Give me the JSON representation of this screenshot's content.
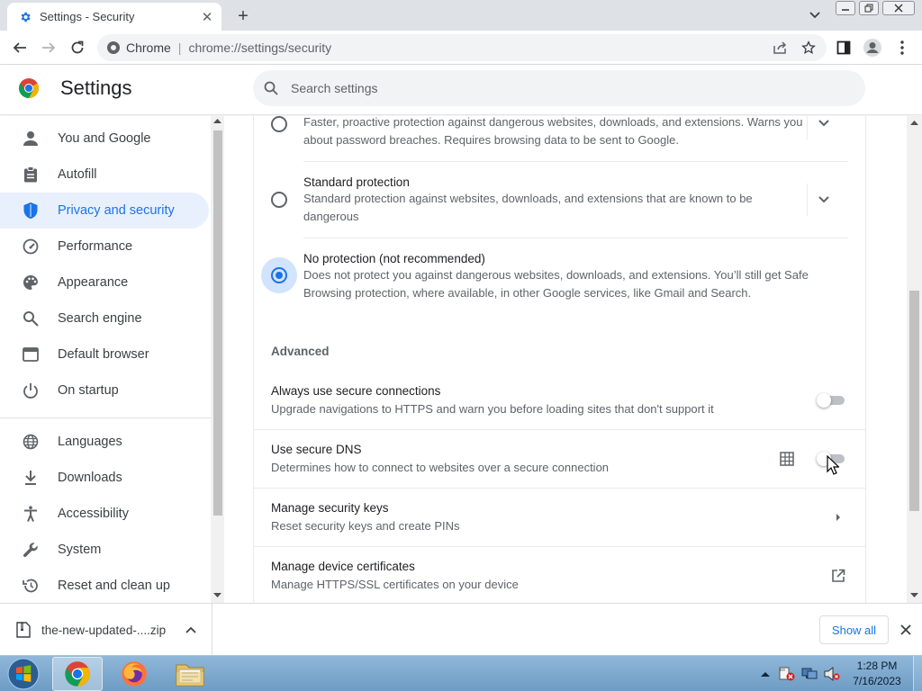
{
  "browser": {
    "tab_title": "Settings - Security",
    "omnibox_chip": "Chrome",
    "omnibox_url": "chrome://settings/security"
  },
  "settings": {
    "title": "Settings",
    "search_placeholder": "Search settings"
  },
  "sidebar": {
    "items": [
      {
        "label": "You and Google",
        "icon": "person-icon"
      },
      {
        "label": "Autofill",
        "icon": "clipboard-icon"
      },
      {
        "label": "Privacy and security",
        "icon": "shield-icon",
        "active": true
      },
      {
        "label": "Performance",
        "icon": "speedometer-icon"
      },
      {
        "label": "Appearance",
        "icon": "palette-icon"
      },
      {
        "label": "Search engine",
        "icon": "search-icon"
      },
      {
        "label": "Default browser",
        "icon": "browser-window-icon"
      },
      {
        "label": "On startup",
        "icon": "power-icon"
      },
      {
        "label": "Languages",
        "icon": "globe-icon"
      },
      {
        "label": "Downloads",
        "icon": "download-icon"
      },
      {
        "label": "Accessibility",
        "icon": "accessibility-icon"
      },
      {
        "label": "System",
        "icon": "wrench-icon"
      },
      {
        "label": "Reset and clean up",
        "icon": "restore-icon"
      }
    ]
  },
  "security": {
    "enhanced": {
      "desc": "Faster, proactive protection against dangerous websites, downloads, and extensions. Warns you about password breaches. Requires browsing data to be sent to Google.",
      "selected": false
    },
    "standard": {
      "title": "Standard protection",
      "desc": "Standard protection against websites, downloads, and extensions that are known to be dangerous",
      "selected": false
    },
    "none": {
      "title": "No protection (not recommended)",
      "desc": "Does not protect you against dangerous websites, downloads, and extensions. You’ll still get Safe Browsing protection, where available, in other Google services, like Gmail and Search.",
      "selected": true
    },
    "advanced_label": "Advanced",
    "secure_connections": {
      "title": "Always use secure connections",
      "desc": "Upgrade navigations to HTTPS and warn you before loading sites that don't support it",
      "enabled": false
    },
    "secure_dns": {
      "title": "Use secure DNS",
      "desc": "Determines how to connect to websites over a secure connection",
      "enabled": false
    },
    "security_keys": {
      "title": "Manage security keys",
      "desc": "Reset security keys and create PINs"
    },
    "certificates": {
      "title": "Manage device certificates",
      "desc": "Manage HTTPS/SSL certificates on your device"
    }
  },
  "downloads_bar": {
    "filename": "the-new-updated-....zip",
    "show_all": "Show all"
  },
  "taskbar": {
    "time": "1:28 PM",
    "date": "7/16/2023"
  },
  "colors": {
    "accent": "#1a73e8",
    "active_nav_bg": "#e8f0fe"
  }
}
